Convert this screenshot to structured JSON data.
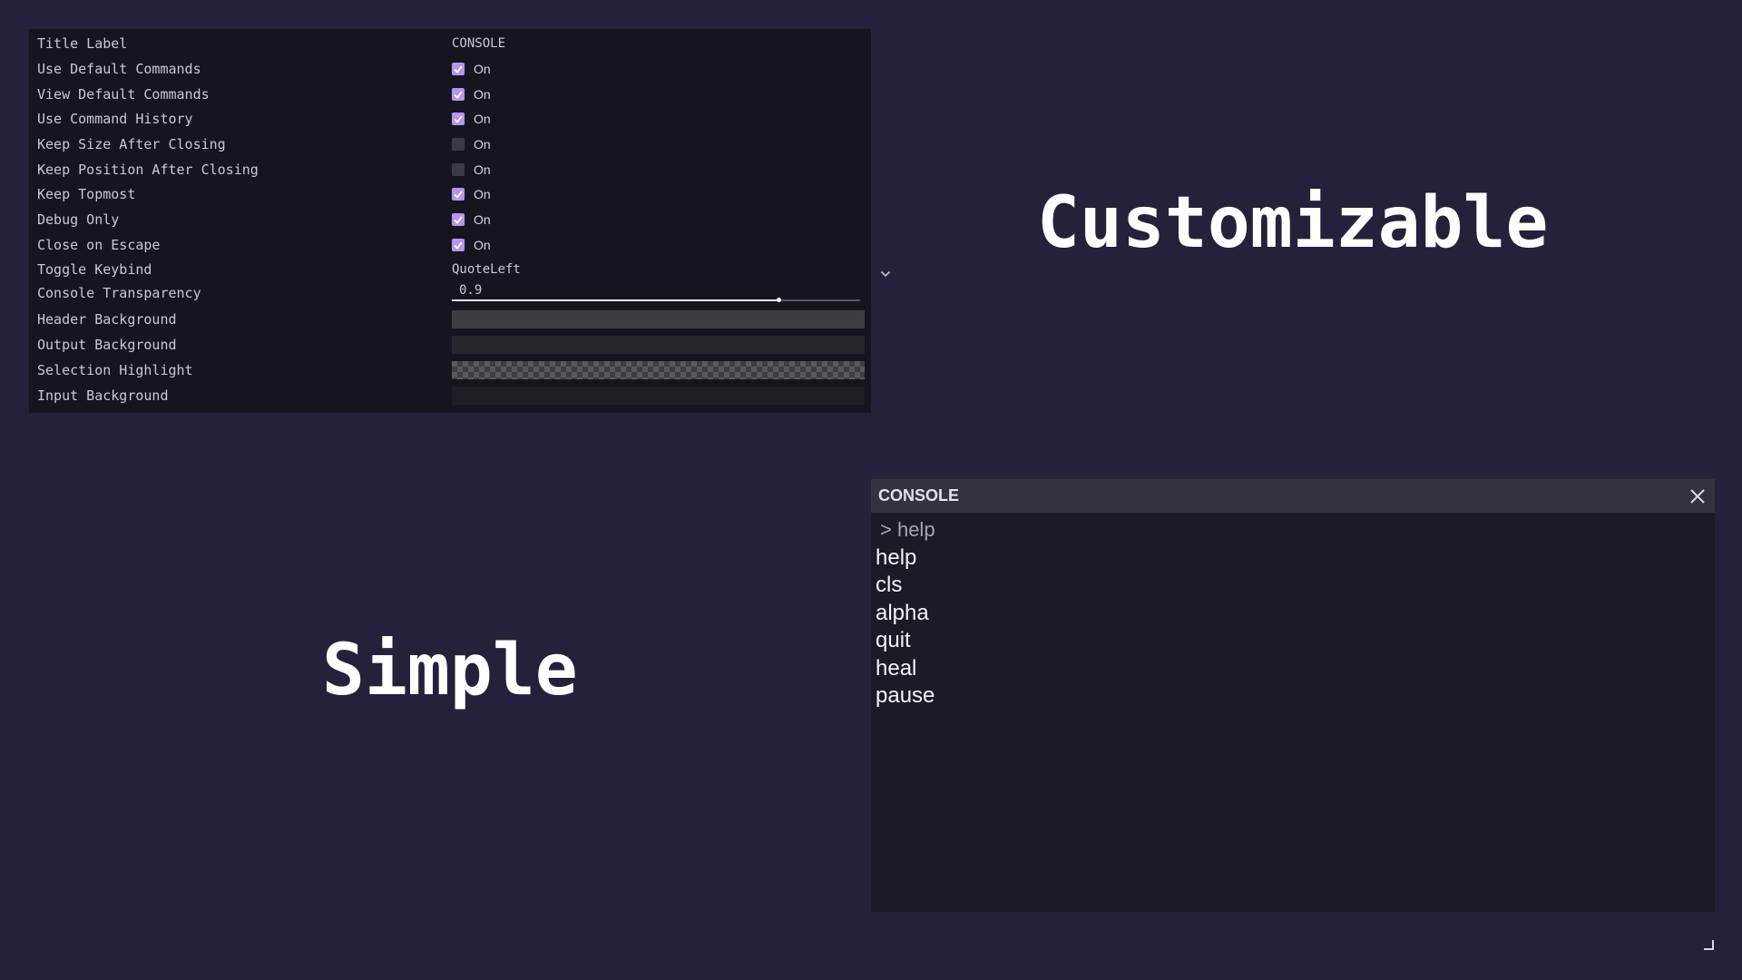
{
  "colors": {
    "background": "#23223a",
    "panel": "#16151f",
    "accent_check": "#b596e8",
    "header_background": "#33323f",
    "output_background": "#1b1a25"
  },
  "inspector": {
    "rows": [
      {
        "label": "Title Label",
        "type": "text",
        "value": "CONSOLE"
      },
      {
        "label": "Use Default Commands",
        "type": "checkbox",
        "checked": true,
        "value": "On"
      },
      {
        "label": "View Default Commands",
        "type": "checkbox",
        "checked": true,
        "value": "On"
      },
      {
        "label": "Use Command History",
        "type": "checkbox",
        "checked": true,
        "value": "On"
      },
      {
        "label": "Keep Size After Closing",
        "type": "checkbox",
        "checked": false,
        "value": "On"
      },
      {
        "label": "Keep Position After Closing",
        "type": "checkbox",
        "checked": false,
        "value": "On"
      },
      {
        "label": "Keep Topmost",
        "type": "checkbox",
        "checked": true,
        "value": "On"
      },
      {
        "label": "Debug Only",
        "type": "checkbox",
        "checked": true,
        "value": "On"
      },
      {
        "label": "Close on Escape",
        "type": "checkbox",
        "checked": true,
        "value": "On"
      },
      {
        "label": "Toggle Keybind",
        "type": "dropdown",
        "value": "QuoteLeft",
        "icon": "chevron-down-icon"
      },
      {
        "label": "Console Transparency",
        "type": "slider",
        "value": "0.9",
        "fraction": 0.8
      },
      {
        "label": "Header Background",
        "type": "color",
        "color": "#3d3c40"
      },
      {
        "label": "Output Background",
        "type": "color",
        "color": "#27262d"
      },
      {
        "label": "Selection Highlight",
        "type": "color",
        "color": "checker"
      },
      {
        "label": "Input Background",
        "type": "color",
        "color": "#1f1e25"
      }
    ]
  },
  "captions": {
    "customizable": "Customizable",
    "simple": "Simple"
  },
  "console": {
    "title": "CONSOLE",
    "close_icon": "close-icon",
    "echo": "> help",
    "output": [
      "help",
      "cls",
      "alpha",
      "quit",
      "heal",
      "pause"
    ],
    "input_value": "",
    "resize_icon": "resize-handle-icon"
  }
}
